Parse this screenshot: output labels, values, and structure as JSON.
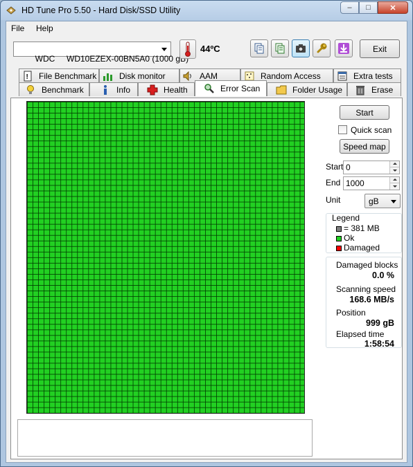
{
  "window": {
    "title": "HD Tune Pro 5.50 - Hard Disk/SSD Utility",
    "controls": {
      "minimize": "–",
      "maximize": "□",
      "close": "✕"
    }
  },
  "menu": {
    "file": "File",
    "help": "Help"
  },
  "toolbar": {
    "drive": "WDC     WD10EZEX-00BN5A0 (1000 gB)",
    "temperature": "44ºC",
    "exit_label": "Exit"
  },
  "tabs": {
    "top": [
      "File Benchmark",
      "Disk monitor",
      "AAM",
      "Random Access",
      "Extra tests"
    ],
    "bottom": [
      "Benchmark",
      "Info",
      "Health",
      "Error Scan",
      "Folder Usage",
      "Erase"
    ]
  },
  "scan": {
    "start_button": "Start",
    "quick_scan_label": "Quick scan",
    "quick_scan_checked": false,
    "speed_map_button": "Speed map",
    "start_label": "Start",
    "start_value": "0",
    "end_label": "End",
    "end_value": "1000",
    "unit_label": "Unit",
    "unit_value": "gB"
  },
  "legend": {
    "title": "Legend",
    "block_size": "= 381 MB",
    "ok": "Ok",
    "damaged": "Damaged",
    "colors": {
      "block": "#808080",
      "ok": "#22d022",
      "damaged": "#ff0000"
    }
  },
  "stats": {
    "damaged_blocks_label": "Damaged blocks",
    "damaged_blocks_value": "0.0 %",
    "scanning_speed_label": "Scanning speed",
    "scanning_speed_value": "168.6 MB/s",
    "position_label": "Position",
    "position_value": "999 gB",
    "elapsed_label": "Elapsed time",
    "elapsed_value": "1:58:54"
  },
  "scan_grid": {
    "state": "all blocks ok",
    "fill_color": "#22d022"
  }
}
